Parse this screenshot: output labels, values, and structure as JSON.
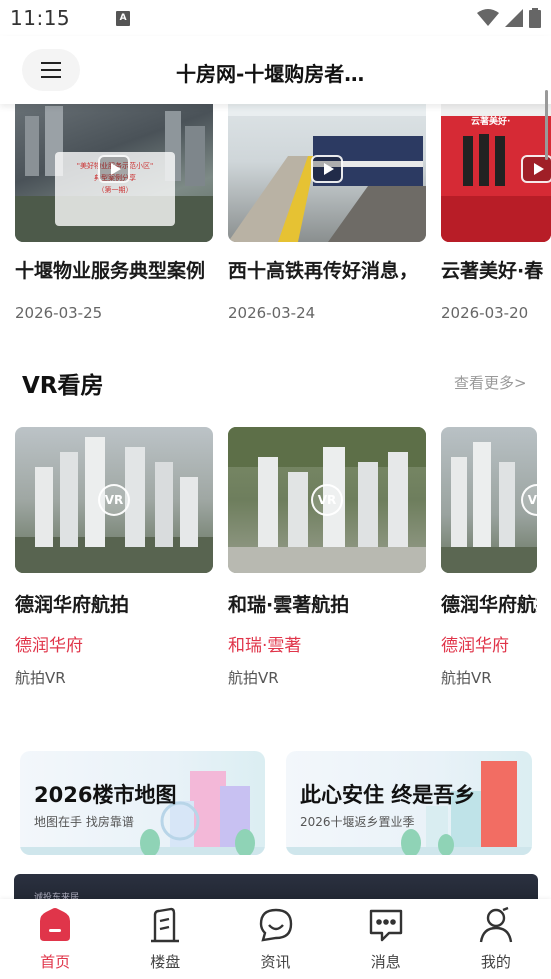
{
  "status_bar": {
    "time": "11:15",
    "sim_label": "A"
  },
  "header": {
    "title": "十房网-十堰购房者…"
  },
  "news": [
    {
      "title": "十堰物业服务典型案例",
      "date": "2026-03-25",
      "thumb_text": "\"美好物业服务示范小区\"\n典型案例分享\n（第一期）"
    },
    {
      "title": "西十高铁再传好消息，",
      "date": "2026-03-24"
    },
    {
      "title": "云著美好·春",
      "date": "2026-03-20",
      "thumb_text": "云著美好·"
    }
  ],
  "vr_section": {
    "title": "VR看房",
    "more": "查看更多>",
    "badge": "VR",
    "items": [
      {
        "title": "德润华府航拍",
        "project": "德润华府",
        "tag": "航拍VR"
      },
      {
        "title": "和瑞·雲著航拍",
        "project": "和瑞·雲著",
        "tag": "航拍VR"
      },
      {
        "title": "德润华府航拍",
        "project": "德润华府",
        "tag": "航拍VR"
      }
    ]
  },
  "banners": [
    {
      "title": "2026楼市地图",
      "subtitle": "地图在手 找房靠谱"
    },
    {
      "title": "此心安住 终是吾乡",
      "subtitle": "2026十堰返乡置业季"
    }
  ],
  "dark_strip_text": "诚投东来居",
  "tabs": [
    {
      "label": "首页",
      "icon": "home-icon",
      "active": true
    },
    {
      "label": "楼盘",
      "icon": "building-icon",
      "active": false
    },
    {
      "label": "资讯",
      "icon": "news-chat-icon",
      "active": false
    },
    {
      "label": "消息",
      "icon": "message-icon",
      "active": false
    },
    {
      "label": "我的",
      "icon": "profile-icon",
      "active": false
    }
  ],
  "colors": {
    "accent": "#e0354a",
    "text": "#1a1a1a",
    "muted": "#999999"
  }
}
